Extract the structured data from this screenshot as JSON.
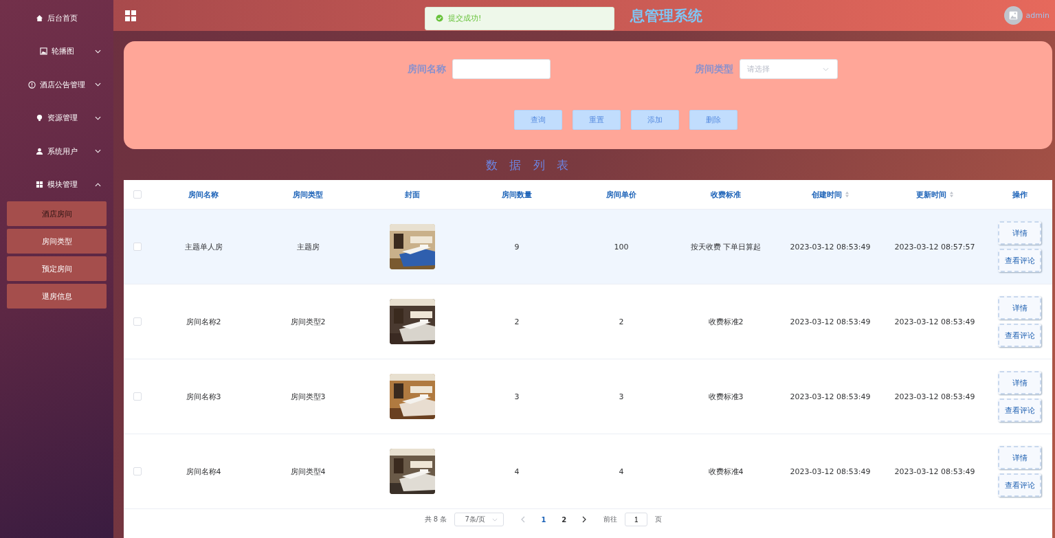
{
  "sidebar": {
    "items": [
      {
        "label": "后台首页"
      },
      {
        "label": "轮播图",
        "expanded": false
      },
      {
        "label": "酒店公告管理",
        "expanded": false
      },
      {
        "label": "资源管理",
        "expanded": false
      },
      {
        "label": "系统用户",
        "expanded": false
      },
      {
        "label": "模块管理",
        "expanded": true,
        "children": [
          {
            "label": "酒店房间",
            "selected": true
          },
          {
            "label": "房间类型",
            "selected": false
          },
          {
            "label": "预定房间",
            "selected": false
          },
          {
            "label": "退房信息",
            "selected": false
          }
        ]
      }
    ]
  },
  "header": {
    "title": "息管理系统",
    "user": "admin"
  },
  "toast": {
    "message": "提交成功!"
  },
  "search": {
    "fields": [
      {
        "label": "房间名称",
        "kind": "text"
      },
      {
        "label": "房间类型",
        "kind": "select",
        "placeholder": "请选择"
      }
    ],
    "buttons": [
      "查询",
      "重置",
      "添加",
      "删除"
    ]
  },
  "list_title": "数 据 列 表",
  "table": {
    "all_checked": false,
    "columns": [
      {
        "label": "房间名称",
        "sortable": false
      },
      {
        "label": "房间类型",
        "sortable": false
      },
      {
        "label": "封面",
        "sortable": false
      },
      {
        "label": "房间数量",
        "sortable": false
      },
      {
        "label": "房间单价",
        "sortable": false
      },
      {
        "label": "收费标准",
        "sortable": false
      },
      {
        "label": "创建时间",
        "sortable": true
      },
      {
        "label": "更新时间",
        "sortable": true
      },
      {
        "label": "操作",
        "sortable": false
      }
    ],
    "rows": [
      {
        "selected": true,
        "checked": false,
        "cells": [
          "主题单人房",
          "主题房",
          {
            "kind": "picture"
          },
          "9",
          "100",
          "按天收费 下单日算起",
          "2023-03-12 08:53:49",
          "2023-03-12 08:57:57"
        ],
        "actions": [
          "详情",
          "查看评论"
        ]
      },
      {
        "selected": false,
        "checked": false,
        "cells": [
          "房间名称2",
          "房间类型2",
          {
            "kind": "picture"
          },
          "2",
          "2",
          "收费标准2",
          "2023-03-12 08:53:49",
          "2023-03-12 08:53:49"
        ],
        "actions": [
          "详情",
          "查看评论"
        ]
      },
      {
        "selected": false,
        "checked": false,
        "cells": [
          "房间名称3",
          "房间类型3",
          {
            "kind": "picture"
          },
          "3",
          "3",
          "收费标准3",
          "2023-03-12 08:53:49",
          "2023-03-12 08:53:49"
        ],
        "actions": [
          "详情",
          "查看评论"
        ]
      },
      {
        "selected": false,
        "checked": false,
        "cells": [
          "房间名称4",
          "房间类型4",
          {
            "kind": "picture"
          },
          "4",
          "4",
          "收费标准4",
          "2023-03-12 08:53:49",
          "2023-03-12 08:53:49"
        ],
        "actions": [
          "详情",
          "查看评论"
        ]
      }
    ]
  },
  "pagination": {
    "total": "共 8 条",
    "page_size": "7条/页",
    "pages": [
      {
        "label": "1",
        "selected": true
      },
      {
        "label": "2",
        "selected": false
      }
    ],
    "goto_label": "前往",
    "goto_value": "1",
    "goto_suffix": "页"
  }
}
